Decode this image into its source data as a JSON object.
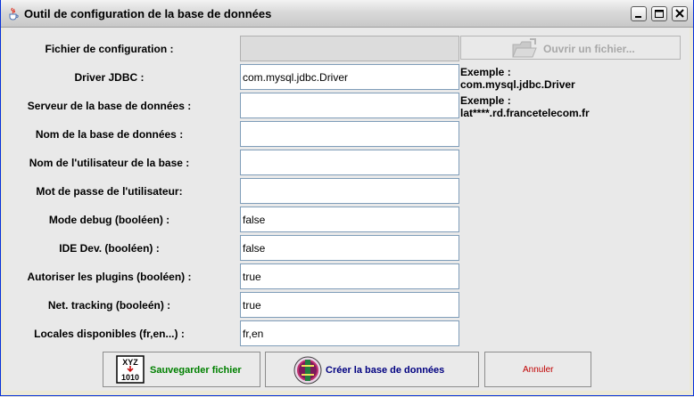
{
  "window": {
    "title": "Outil de configuration de la base de données"
  },
  "form": {
    "fields": [
      {
        "label": "Fichier de configuration :",
        "value": "",
        "disabled": true
      },
      {
        "label": "Driver JDBC :",
        "value": "com.mysql.jdbc.Driver"
      },
      {
        "label": "Serveur de la base de données :",
        "value": ""
      },
      {
        "label": "Nom de la base de données :",
        "value": ""
      },
      {
        "label": "Nom de l'utilisateur de la base :",
        "value": ""
      },
      {
        "label": "Mot de passe de l'utilisateur:",
        "value": ""
      },
      {
        "label": "Mode debug (booléen) :",
        "value": "false"
      },
      {
        "label": "IDE Dev. (booléen) :",
        "value": "false"
      },
      {
        "label": "Autoriser les plugins (booléen) :",
        "value": "true"
      },
      {
        "label": "Net. tracking (booleén) :",
        "value": "true"
      },
      {
        "label": "Locales disponibles (fr,en...) :",
        "value": "fr,en"
      }
    ],
    "open_file_label": "Ouvrir un fichier...",
    "hints": {
      "driver_line1": "Exemple :",
      "driver_line2": "com.mysql.jdbc.Driver",
      "server_line1": "Exemple :",
      "server_line2": "lat****.rd.francetelecom.fr"
    }
  },
  "buttons": {
    "save_label": "Sauvegarder fichier",
    "create_label": "Créer la base de données",
    "cancel_label": "Annuler",
    "save_icon_text_top": "XYZ",
    "save_icon_text_bottom": "1010"
  },
  "colors": {
    "save_text": "#008000",
    "create_text": "#000080",
    "cancel_text": "#c00000",
    "disabled_text": "#a8a8a8"
  },
  "icons": {
    "app": "java-cup-icon",
    "minimize": "minimize-icon",
    "maximize": "maximize-icon",
    "close": "close-icon",
    "open": "folder-open-icon",
    "save": "save-file-icon",
    "create": "database-icon"
  }
}
